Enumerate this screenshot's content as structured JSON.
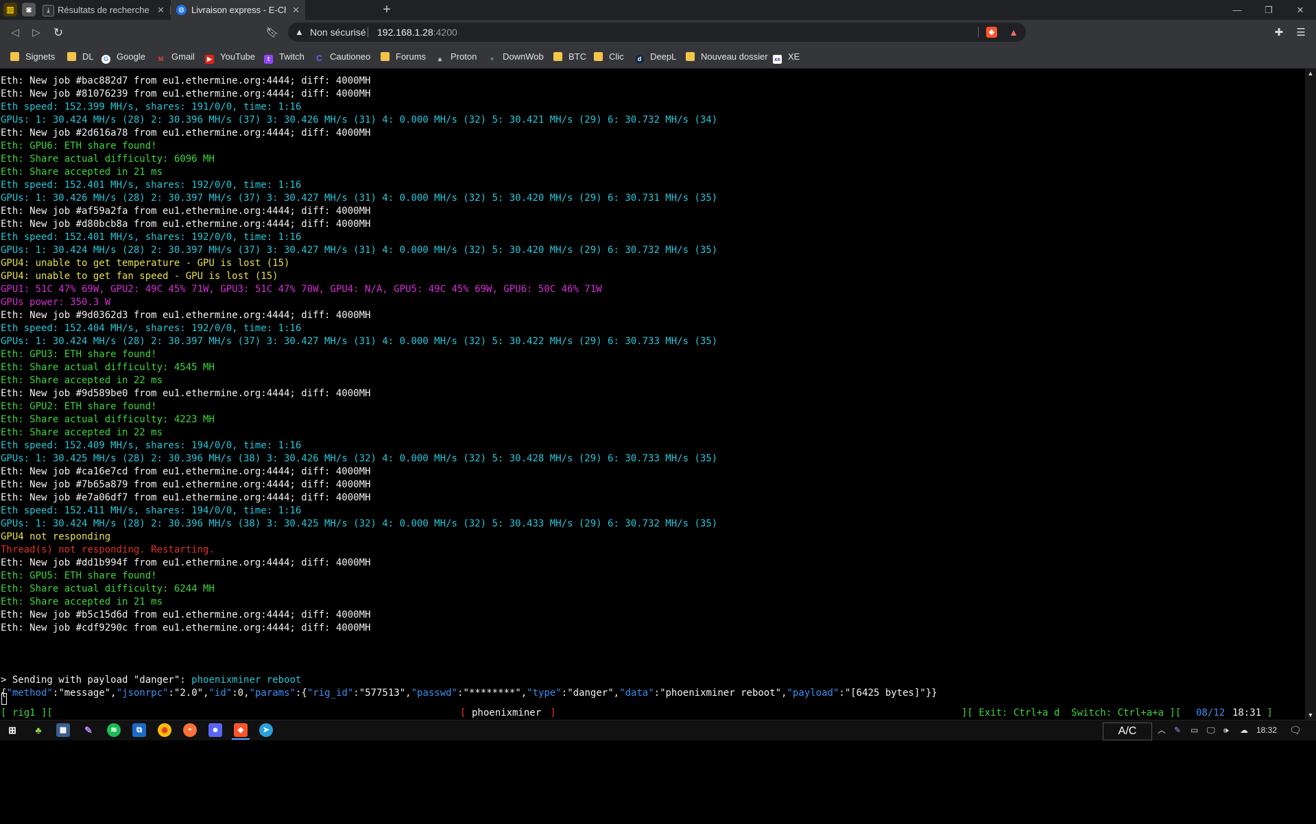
{
  "browser": {
    "tabs": [
      {
        "title": "Résultats de recherche pour \"chrono\"",
        "favicon": "doc-icon",
        "active": false
      },
      {
        "title": "Livraison express - E-Chrono | Chrono",
        "favicon": "globe-icon",
        "active": true
      }
    ],
    "new_tab_symbol": "+",
    "window_controls": {
      "minimize": "—",
      "restore": "❐",
      "close": "✕"
    },
    "address": {
      "security_label": "Non sécurisé",
      "host": "192.168.1.28",
      "port": ":4200"
    },
    "bookmarks": [
      {
        "label": "Signets",
        "icon": "folder-icon"
      },
      {
        "label": "DL",
        "icon": "folder-icon"
      },
      {
        "label": "Google",
        "icon": "google-icon"
      },
      {
        "label": "Gmail",
        "icon": "gmail-icon"
      },
      {
        "label": "YouTube",
        "icon": "youtube-icon"
      },
      {
        "label": "Twitch",
        "icon": "twitch-icon"
      },
      {
        "label": "Cautioneo",
        "icon": "cautioneo-icon"
      },
      {
        "label": "Forums",
        "icon": "folder-icon"
      },
      {
        "label": "Proton",
        "icon": "proton-icon"
      },
      {
        "label": "DownWob",
        "icon": "downwob-icon"
      },
      {
        "label": "BTC",
        "icon": "folder-icon"
      },
      {
        "label": "Clic",
        "icon": "folder-icon"
      },
      {
        "label": "DeepL",
        "icon": "deepl-icon"
      },
      {
        "label": "Nouveau dossier",
        "icon": "folder-icon"
      },
      {
        "label": "XE",
        "icon": "xe-icon"
      }
    ]
  },
  "terminal": {
    "lines": [
      {
        "text": "Eth: New job #bac882d7 from eu1.ethermine.org:4444; diff: 4000MH",
        "color": "white"
      },
      {
        "text": "Eth: New job #81076239 from eu1.ethermine.org:4444; diff: 4000MH",
        "color": "white"
      },
      {
        "text": "Eth speed: 152.399 MH/s, shares: 191/0/0, time: 1:16",
        "color": "cyan"
      },
      {
        "text": "GPUs: 1: 30.424 MH/s (28) 2: 30.396 MH/s (37) 3: 30.426 MH/s (31) 4: 0.000 MH/s (32) 5: 30.421 MH/s (29) 6: 30.732 MH/s (34)",
        "color": "cyan"
      },
      {
        "text": "Eth: New job #2d616a78 from eu1.ethermine.org:4444; diff: 4000MH",
        "color": "white"
      },
      {
        "text": "Eth: GPU6: ETH share found!",
        "color": "green"
      },
      {
        "text": "Eth: Share actual difficulty: 6096 MH",
        "color": "green"
      },
      {
        "text": "Eth: Share accepted in 21 ms",
        "color": "green"
      },
      {
        "text": "Eth speed: 152.401 MH/s, shares: 192/0/0, time: 1:16",
        "color": "cyan"
      },
      {
        "text": "GPUs: 1: 30.426 MH/s (28) 2: 30.397 MH/s (37) 3: 30.427 MH/s (31) 4: 0.000 MH/s (32) 5: 30.420 MH/s (29) 6: 30.731 MH/s (35)",
        "color": "cyan"
      },
      {
        "text": "Eth: New job #af59a2fa from eu1.ethermine.org:4444; diff: 4000MH",
        "color": "white"
      },
      {
        "text": "Eth: New job #d80bcb8a from eu1.ethermine.org:4444; diff: 4000MH",
        "color": "white"
      },
      {
        "text": "Eth speed: 152.401 MH/s, shares: 192/0/0, time: 1:16",
        "color": "cyan"
      },
      {
        "text": "GPUs: 1: 30.424 MH/s (28) 2: 30.397 MH/s (37) 3: 30.427 MH/s (31) 4: 0.000 MH/s (32) 5: 30.420 MH/s (29) 6: 30.732 MH/s (35)",
        "color": "cyan"
      },
      {
        "text": "GPU4: unable to get temperature - GPU is lost (15)",
        "color": "yellow"
      },
      {
        "text": "GPU4: unable to get fan speed - GPU is lost (15)",
        "color": "yellow"
      },
      {
        "text": "GPU1: 51C 47% 69W, GPU2: 49C 45% 71W, GPU3: 51C 47% 70W, GPU4: N/A, GPU5: 49C 45% 69W, GPU6: 50C 46% 71W",
        "color": "magenta"
      },
      {
        "text": "GPUs power: 350.3 W",
        "color": "magenta"
      },
      {
        "text": "Eth: New job #9d0362d3 from eu1.ethermine.org:4444; diff: 4000MH",
        "color": "white"
      },
      {
        "text": "Eth speed: 152.404 MH/s, shares: 192/0/0, time: 1:16",
        "color": "cyan"
      },
      {
        "text": "GPUs: 1: 30.424 MH/s (28) 2: 30.397 MH/s (37) 3: 30.427 MH/s (31) 4: 0.000 MH/s (32) 5: 30.422 MH/s (29) 6: 30.733 MH/s (35)",
        "color": "cyan"
      },
      {
        "text": "Eth: GPU3: ETH share found!",
        "color": "green"
      },
      {
        "text": "Eth: Share actual difficulty: 4545 MH",
        "color": "green"
      },
      {
        "text": "Eth: Share accepted in 22 ms",
        "color": "green"
      },
      {
        "text": "Eth: New job #9d589be0 from eu1.ethermine.org:4444; diff: 4000MH",
        "color": "white"
      },
      {
        "text": "Eth: GPU2: ETH share found!",
        "color": "green"
      },
      {
        "text": "Eth: Share actual difficulty: 4223 MH",
        "color": "green"
      },
      {
        "text": "Eth: Share accepted in 22 ms",
        "color": "green"
      },
      {
        "text": "Eth speed: 152.409 MH/s, shares: 194/0/0, time: 1:16",
        "color": "cyan"
      },
      {
        "text": "GPUs: 1: 30.425 MH/s (28) 2: 30.396 MH/s (38) 3: 30.426 MH/s (32) 4: 0.000 MH/s (32) 5: 30.428 MH/s (29) 6: 30.733 MH/s (35)",
        "color": "cyan"
      },
      {
        "text": "Eth: New job #ca16e7cd from eu1.ethermine.org:4444; diff: 4000MH",
        "color": "white"
      },
      {
        "text": "Eth: New job #7b65a879 from eu1.ethermine.org:4444; diff: 4000MH",
        "color": "white"
      },
      {
        "text": "Eth: New job #e7a06df7 from eu1.ethermine.org:4444; diff: 4000MH",
        "color": "white"
      },
      {
        "text": "Eth speed: 152.411 MH/s, shares: 194/0/0, time: 1:16",
        "color": "cyan"
      },
      {
        "text": "GPUs: 1: 30.424 MH/s (28) 2: 30.396 MH/s (38) 3: 30.425 MH/s (32) 4: 0.000 MH/s (32) 5: 30.433 MH/s (29) 6: 30.732 MH/s (35)",
        "color": "cyan"
      },
      {
        "text": "GPU4 not responding",
        "color": "yellow"
      },
      {
        "text": "Thread(s) not responding. Restarting.",
        "color": "red"
      },
      {
        "text": "Eth: New job #dd1b994f from eu1.ethermine.org:4444; diff: 4000MH",
        "color": "white"
      },
      {
        "text": "Eth: GPU5: ETH share found!",
        "color": "green"
      },
      {
        "text": "Eth: Share actual difficulty: 6244 MH",
        "color": "green"
      },
      {
        "text": "Eth: Share accepted in 21 ms",
        "color": "green"
      },
      {
        "text": "Eth: New job #b5c15d6d from eu1.ethermine.org:4444; diff: 4000MH",
        "color": "white"
      },
      {
        "text": "Eth: New job #cdf9290c from eu1.ethermine.org:4444; diff: 4000MH",
        "color": "white"
      }
    ],
    "sending": {
      "prefix": "> Sending with payload \"danger\": ",
      "command": "phoenixminer reboot"
    },
    "json_segments": [
      {
        "t": "{",
        "c": "wht"
      },
      {
        "t": "\"method\"",
        "c": "blue"
      },
      {
        "t": ":",
        "c": "wht"
      },
      {
        "t": "\"message\"",
        "c": "wht"
      },
      {
        "t": ",",
        "c": "wht"
      },
      {
        "t": "\"jsonrpc\"",
        "c": "blue"
      },
      {
        "t": ":",
        "c": "wht"
      },
      {
        "t": "\"2.0\"",
        "c": "wht"
      },
      {
        "t": ",",
        "c": "wht"
      },
      {
        "t": "\"id\"",
        "c": "blue"
      },
      {
        "t": ":0,",
        "c": "wht"
      },
      {
        "t": "\"params\"",
        "c": "blue"
      },
      {
        "t": ":{",
        "c": "wht"
      },
      {
        "t": "\"rig_id\"",
        "c": "blue"
      },
      {
        "t": ":",
        "c": "wht"
      },
      {
        "t": "\"577513\"",
        "c": "wht"
      },
      {
        "t": ",",
        "c": "wht"
      },
      {
        "t": "\"passwd\"",
        "c": "blue"
      },
      {
        "t": ":",
        "c": "wht"
      },
      {
        "t": "\"********\"",
        "c": "wht"
      },
      {
        "t": ",",
        "c": "wht"
      },
      {
        "t": "\"type\"",
        "c": "blue"
      },
      {
        "t": ":",
        "c": "wht"
      },
      {
        "t": "\"danger\"",
        "c": "wht"
      },
      {
        "t": ",",
        "c": "wht"
      },
      {
        "t": "\"data\"",
        "c": "blue"
      },
      {
        "t": ":",
        "c": "wht"
      },
      {
        "t": "\"phoenixminer reboot\"",
        "c": "wht"
      },
      {
        "t": ",",
        "c": "wht"
      },
      {
        "t": "\"payload\"",
        "c": "blue"
      },
      {
        "t": ":",
        "c": "wht"
      },
      {
        "t": "\"[6425 bytes]\"",
        "c": "wht"
      },
      {
        "t": "}}",
        "c": "wht"
      }
    ],
    "status": {
      "left": "[ rig1 ][",
      "window_name": "phoenixminer",
      "window_brackets_open": "[",
      "window_brackets_close": "]",
      "help": "][ Exit: Ctrl+a d  Switch: Ctrl+a+a ][",
      "date": "08/12",
      "time": "18:31",
      "end": " ]"
    }
  },
  "taskbar": {
    "input_indicator": "A/C",
    "clock": "18:32"
  },
  "colors": {
    "white": "#f2f2f2",
    "cyan": "#29c6d8",
    "green": "#3ed53e",
    "yellow": "#e5e04b",
    "magenta": "#d42fd4",
    "red": "#e0302a",
    "json_key": "#3a8ff0",
    "status_green": "#3ed53e"
  }
}
